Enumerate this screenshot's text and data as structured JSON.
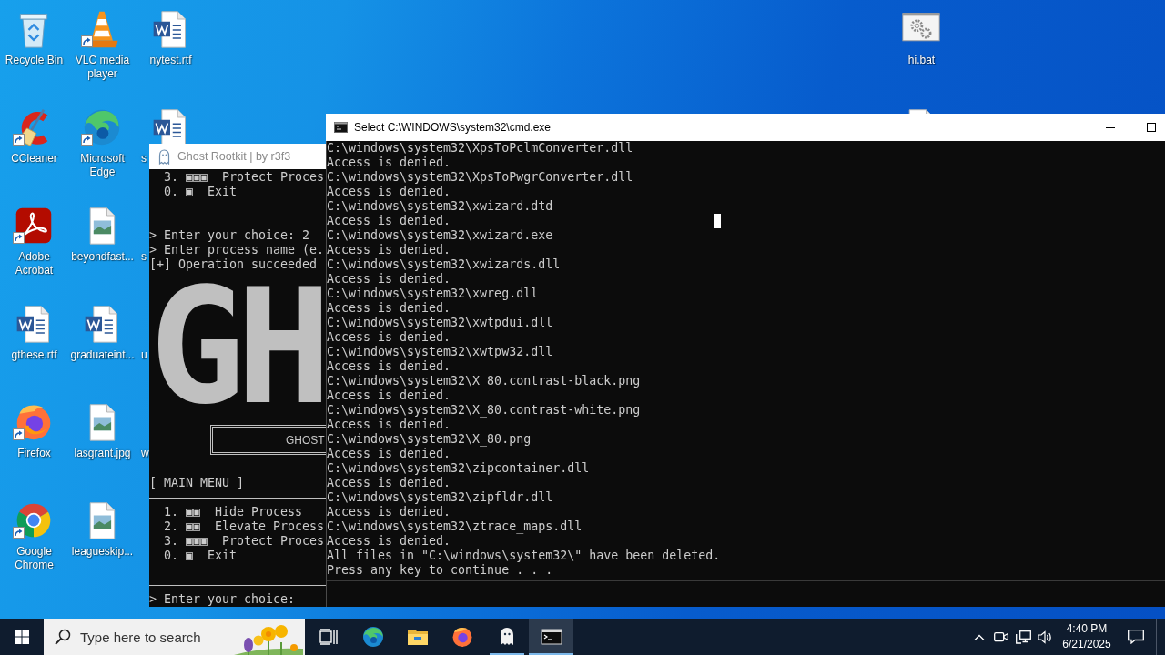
{
  "desktop": {
    "columns": [
      {
        "icons": [
          {
            "label": "Recycle Bin",
            "kind": "recycle-bin",
            "shortcut": false,
            "covered": false
          },
          {
            "label": "CCleaner",
            "kind": "ccleaner",
            "shortcut": true,
            "covered": false
          },
          {
            "label": "Adobe Acrobat",
            "kind": "acrobat",
            "shortcut": true,
            "covered": false
          },
          {
            "label": "gthese.rtf",
            "kind": "word-doc",
            "shortcut": false,
            "covered": false
          },
          {
            "label": "Firefox",
            "kind": "firefox",
            "shortcut": true,
            "covered": false
          },
          {
            "label": "Google Chrome",
            "kind": "chrome",
            "shortcut": true,
            "covered": false
          }
        ]
      },
      {
        "icons": [
          {
            "label": "VLC media player",
            "kind": "vlc",
            "shortcut": true,
            "covered": false
          },
          {
            "label": "Microsoft Edge",
            "kind": "edge",
            "shortcut": true,
            "covered": false
          },
          {
            "label": "beyondfast...",
            "kind": "image-file",
            "shortcut": false,
            "covered": false
          },
          {
            "label": "graduateint...",
            "kind": "word-doc",
            "shortcut": false,
            "covered": false
          },
          {
            "label": "lasgrant.jpg",
            "kind": "image-file",
            "shortcut": false,
            "covered": false
          },
          {
            "label": "leagueskip...",
            "kind": "image-file",
            "shortcut": false,
            "covered": false
          }
        ]
      },
      {
        "icons": [
          {
            "label": "nytest.rtf",
            "kind": "word-doc",
            "shortcut": false,
            "covered": false
          },
          {
            "label": "s",
            "kind": "word-doc",
            "shortcut": false,
            "covered": true
          },
          {
            "label": "s",
            "shortcut": false,
            "covered": true
          },
          {
            "label": "u",
            "shortcut": false,
            "covered": true
          },
          {
            "label": "w",
            "shortcut": false,
            "covered": true
          }
        ]
      }
    ],
    "right_column": [
      {
        "label": "hi.bat",
        "kind": "batch-file",
        "shortcut": false,
        "covered": false
      },
      {
        "kind": "blank-file",
        "shortcut": false,
        "covered": true
      }
    ]
  },
  "ghost_window": {
    "title": "Ghost Rootkit | by r3f3",
    "active": false,
    "console": [
      {
        "kind": "option",
        "text": "3. ▣▣▣  Protect Proces"
      },
      {
        "kind": "option",
        "text": "0. ▣  Exit"
      },
      {
        "kind": "rule"
      },
      {
        "kind": "blank"
      },
      {
        "kind": "line",
        "text": "> Enter your choice: 2"
      },
      {
        "kind": "line",
        "text": "> Enter process name (e."
      },
      {
        "kind": "line",
        "text": "[+] Operation succeeded"
      },
      {
        "kind": "art",
        "text": "GH"
      },
      {
        "kind": "banner",
        "text": "GHOST"
      },
      {
        "kind": "line",
        "text": "[ MAIN MENU ]"
      },
      {
        "kind": "rule"
      },
      {
        "kind": "option",
        "text": "1. ▣▣  Hide Process"
      },
      {
        "kind": "option",
        "text": "2. ▣▣  Elevate Process"
      },
      {
        "kind": "option",
        "text": "3. ▣▣▣  Protect Proces"
      },
      {
        "kind": "option",
        "text": "0. ▣  Exit"
      },
      {
        "kind": "blank"
      },
      {
        "kind": "rule"
      },
      {
        "kind": "line",
        "text": "> Enter your choice:"
      }
    ]
  },
  "cmd_window": {
    "title": "Select C:\\WINDOWS\\system32\\cmd.exe",
    "active": true,
    "lines": [
      "C:\\windows\\system32\\XpsToPclmConverter.dll",
      "Access is denied.",
      "C:\\windows\\system32\\XpsToPwgrConverter.dll",
      "Access is denied.",
      "C:\\windows\\system32\\xwizard.dtd",
      "Access is denied.",
      "C:\\windows\\system32\\xwizard.exe",
      "Access is denied.",
      "C:\\windows\\system32\\xwizards.dll",
      "Access is denied.",
      "C:\\windows\\system32\\xwreg.dll",
      "Access is denied.",
      "C:\\windows\\system32\\xwtpdui.dll",
      "Access is denied.",
      "C:\\windows\\system32\\xwtpw32.dll",
      "Access is denied.",
      "C:\\windows\\system32\\X_80.contrast-black.png",
      "Access is denied.",
      "C:\\windows\\system32\\X_80.contrast-white.png",
      "Access is denied.",
      "C:\\windows\\system32\\X_80.png",
      "Access is denied.",
      "C:\\windows\\system32\\zipcontainer.dll",
      "Access is denied.",
      "C:\\windows\\system32\\zipfldr.dll",
      "Access is denied.",
      "C:\\windows\\system32\\ztrace_maps.dll",
      "Access is denied.",
      "All files in \"C:\\windows\\system32\\\" have been deleted.",
      "Press any key to continue . . ."
    ]
  },
  "taskbar": {
    "search": {
      "placeholder": "Type here to search"
    },
    "apps": [
      {
        "kind": "edge",
        "running": false,
        "selected": false
      },
      {
        "kind": "file-explorer",
        "running": false,
        "selected": false
      },
      {
        "kind": "firefox",
        "running": false,
        "selected": false
      },
      {
        "kind": "ghost",
        "running": true,
        "selected": false
      },
      {
        "kind": "terminal",
        "running": true,
        "selected": true
      }
    ],
    "clock": {
      "time": "4:40 PM",
      "date": "6/21/2025"
    }
  }
}
